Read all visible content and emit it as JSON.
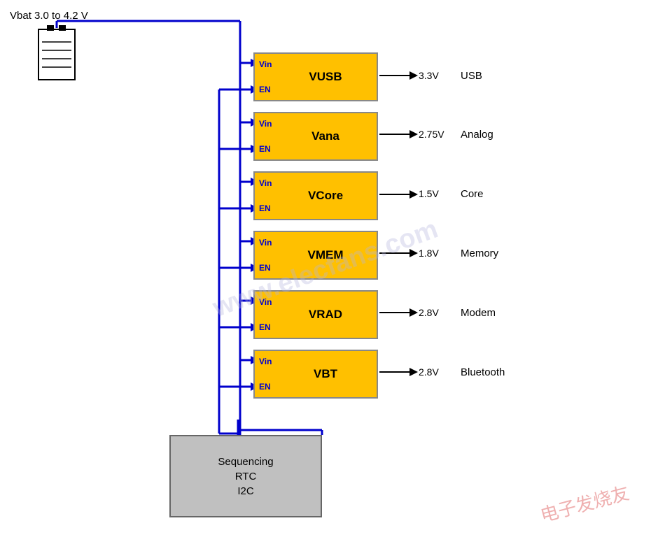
{
  "labels": {
    "vbat": "Vbat 3.0 to 4.2 V"
  },
  "watermark": {
    "text": "www.elecfans.com",
    "chinese": "电子发烧友"
  },
  "regulators": {
    "vusb": {
      "name": "VUSB",
      "vin": "Vin",
      "en": "EN",
      "voltage": "3.3V",
      "dest": "USB"
    },
    "vana": {
      "name": "Vana",
      "vin": "Vin",
      "en": "EN",
      "voltage": "2.75V",
      "dest": "Analog"
    },
    "vcore": {
      "name": "VCore",
      "vin": "Vin",
      "en": "EN",
      "voltage": "1.5V",
      "dest": "Core"
    },
    "vmem": {
      "name": "VMEM",
      "vin": "Vin",
      "en": "EN",
      "voltage": "1.8V",
      "dest": "Memory"
    },
    "vrad": {
      "name": "VRAD",
      "vin": "Vin",
      "en": "EN",
      "voltage": "2.8V",
      "dest": "Modem"
    },
    "vbt": {
      "name": "VBT",
      "vin": "Vin",
      "en": "EN",
      "voltage": "2.8V",
      "dest": "Bluetooth"
    }
  },
  "sequencer": {
    "title": "Sequencing",
    "rtc": "RTC",
    "i2c": "I2C"
  }
}
